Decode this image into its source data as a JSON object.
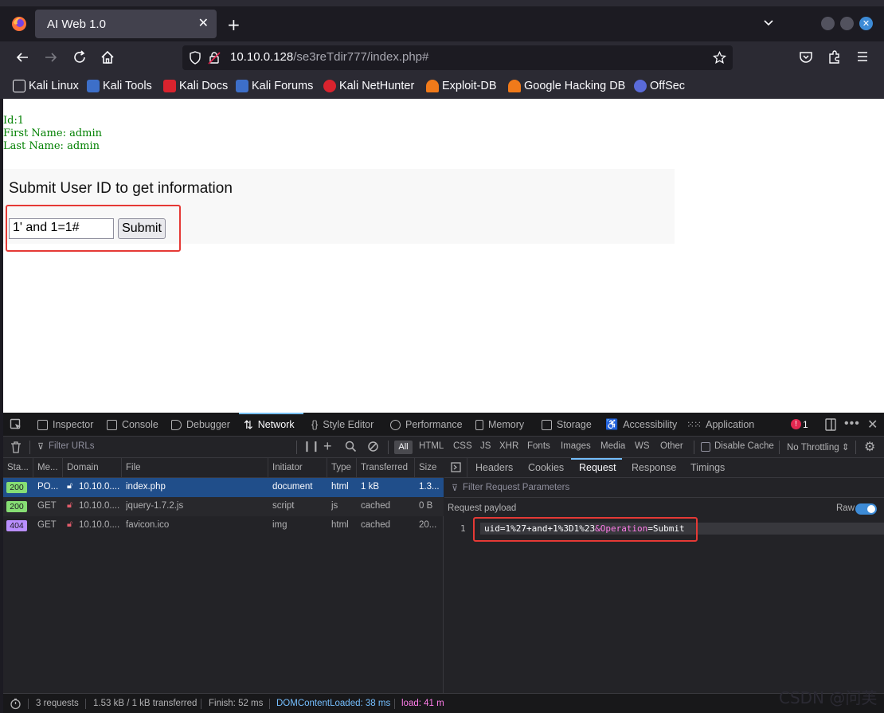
{
  "browser": {
    "tab_title": "AI Web 1.0",
    "url_host": "10.10.0.128",
    "url_path": "/se3reTdir777/index.php#"
  },
  "bookmarks": [
    "Kali Linux",
    "Kali Tools",
    "Kali Docs",
    "Kali Forums",
    "Kali NetHunter",
    "Exploit-DB",
    "Google Hacking DB",
    "OffSec"
  ],
  "page": {
    "result_id": "Id:1",
    "result_first": "First Name: admin",
    "result_last": "Last Name: admin",
    "form_title": "Submit User ID to get information",
    "uid_value": "1' and 1=1#",
    "submit_label": "Submit"
  },
  "devtools": {
    "tabs": [
      "Inspector",
      "Console",
      "Debugger",
      "Network",
      "Style Editor",
      "Performance",
      "Memory",
      "Storage",
      "Accessibility",
      "Application"
    ],
    "error_count": "1",
    "filter_placeholder": "Filter URLs",
    "type_filters": [
      "All",
      "HTML",
      "CSS",
      "JS",
      "XHR",
      "Fonts",
      "Images",
      "Media",
      "WS",
      "Other"
    ],
    "disable_cache": "Disable Cache",
    "throttling": "No Throttling ⇕",
    "columns": [
      "Sta...",
      "Me...",
      "Domain",
      "File",
      "Initiator",
      "Type",
      "Transferred",
      "Size"
    ],
    "requests": [
      {
        "status": "200",
        "method": "PO...",
        "domain": "10.10.0....",
        "file": "index.php",
        "initiator": "document",
        "type": "html",
        "transferred": "1 kB",
        "size": "1.3..."
      },
      {
        "status": "200",
        "method": "GET",
        "domain": "10.10.0....",
        "file": "jquery-1.7.2.js",
        "initiator": "script",
        "type": "js",
        "transferred": "cached",
        "size": "0 B"
      },
      {
        "status": "404",
        "method": "GET",
        "domain": "10.10.0....",
        "file": "favicon.ico",
        "initiator": "img",
        "type": "html",
        "transferred": "cached",
        "size": "20..."
      }
    ],
    "detail_tabs": [
      "Headers",
      "Cookies",
      "Request",
      "Response",
      "Timings"
    ],
    "filter_params_placeholder": "Filter Request Parameters",
    "payload_label": "Request payload",
    "raw_label": "Raw",
    "line_no": "1",
    "payload_part1": "uid=1%27+and+1%3D1%23",
    "payload_part2": "&Operation",
    "payload_part3": "=Submit",
    "status": {
      "requests": "3 requests",
      "transferred": "1.53 kB / 1 kB transferred",
      "finish": "Finish: 52 ms",
      "dom": "DOMContentLoaded: 38 ms",
      "load": "load: 41 m"
    }
  },
  "watermark": "CSDN @问芙",
  "colors": {
    "accent": "#75bfff",
    "selected_row": "#204e8a",
    "status_200": "#86de74",
    "status_404": "#b98eff",
    "highlight_box": "#e53935",
    "result_text": "#008000"
  }
}
